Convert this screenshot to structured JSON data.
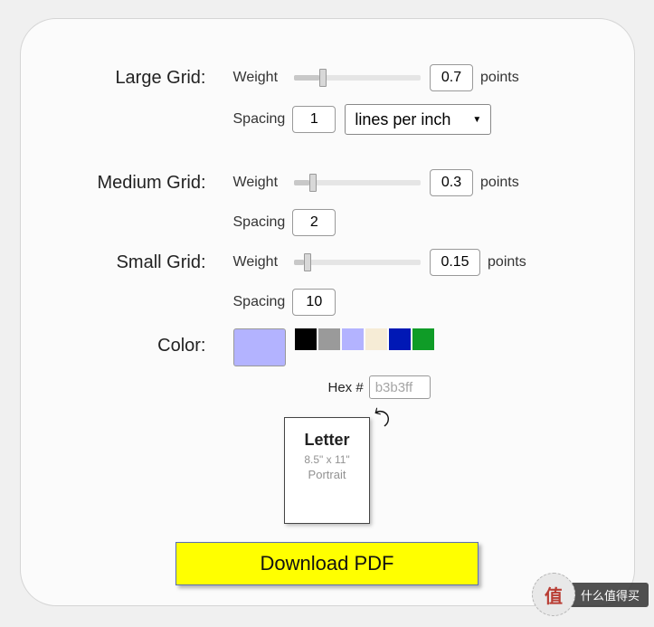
{
  "large_grid": {
    "label": "Large Grid:",
    "weight_label": "Weight",
    "weight_value": "0.7",
    "unit": "points",
    "spacing_label": "Spacing",
    "spacing_value": "1",
    "spacing_unit_selected": "lines per inch",
    "slider_pct": 20
  },
  "medium_grid": {
    "label": "Medium Grid:",
    "weight_label": "Weight",
    "weight_value": "0.3",
    "unit": "points",
    "spacing_label": "Spacing",
    "spacing_value": "2",
    "slider_pct": 12
  },
  "small_grid": {
    "label": "Small Grid:",
    "weight_label": "Weight",
    "weight_value": "0.15",
    "unit": "points",
    "spacing_label": "Spacing",
    "spacing_value": "10",
    "slider_pct": 8
  },
  "color": {
    "label": "Color:",
    "preview": "#b3b3ff",
    "swatches": [
      "#000000",
      "#9a9a9a",
      "#b3b3ff",
      "#f6ecd6",
      "#0018b5",
      "#0f9c27"
    ],
    "hex_label": "Hex #",
    "hex_value": "b3b3ff"
  },
  "paper": {
    "title": "Letter",
    "dimensions": "8.5\" x 11\"",
    "orientation": "Portrait"
  },
  "download_label": "Download PDF",
  "badge": {
    "circle": "值",
    "text": "什么值得买"
  }
}
